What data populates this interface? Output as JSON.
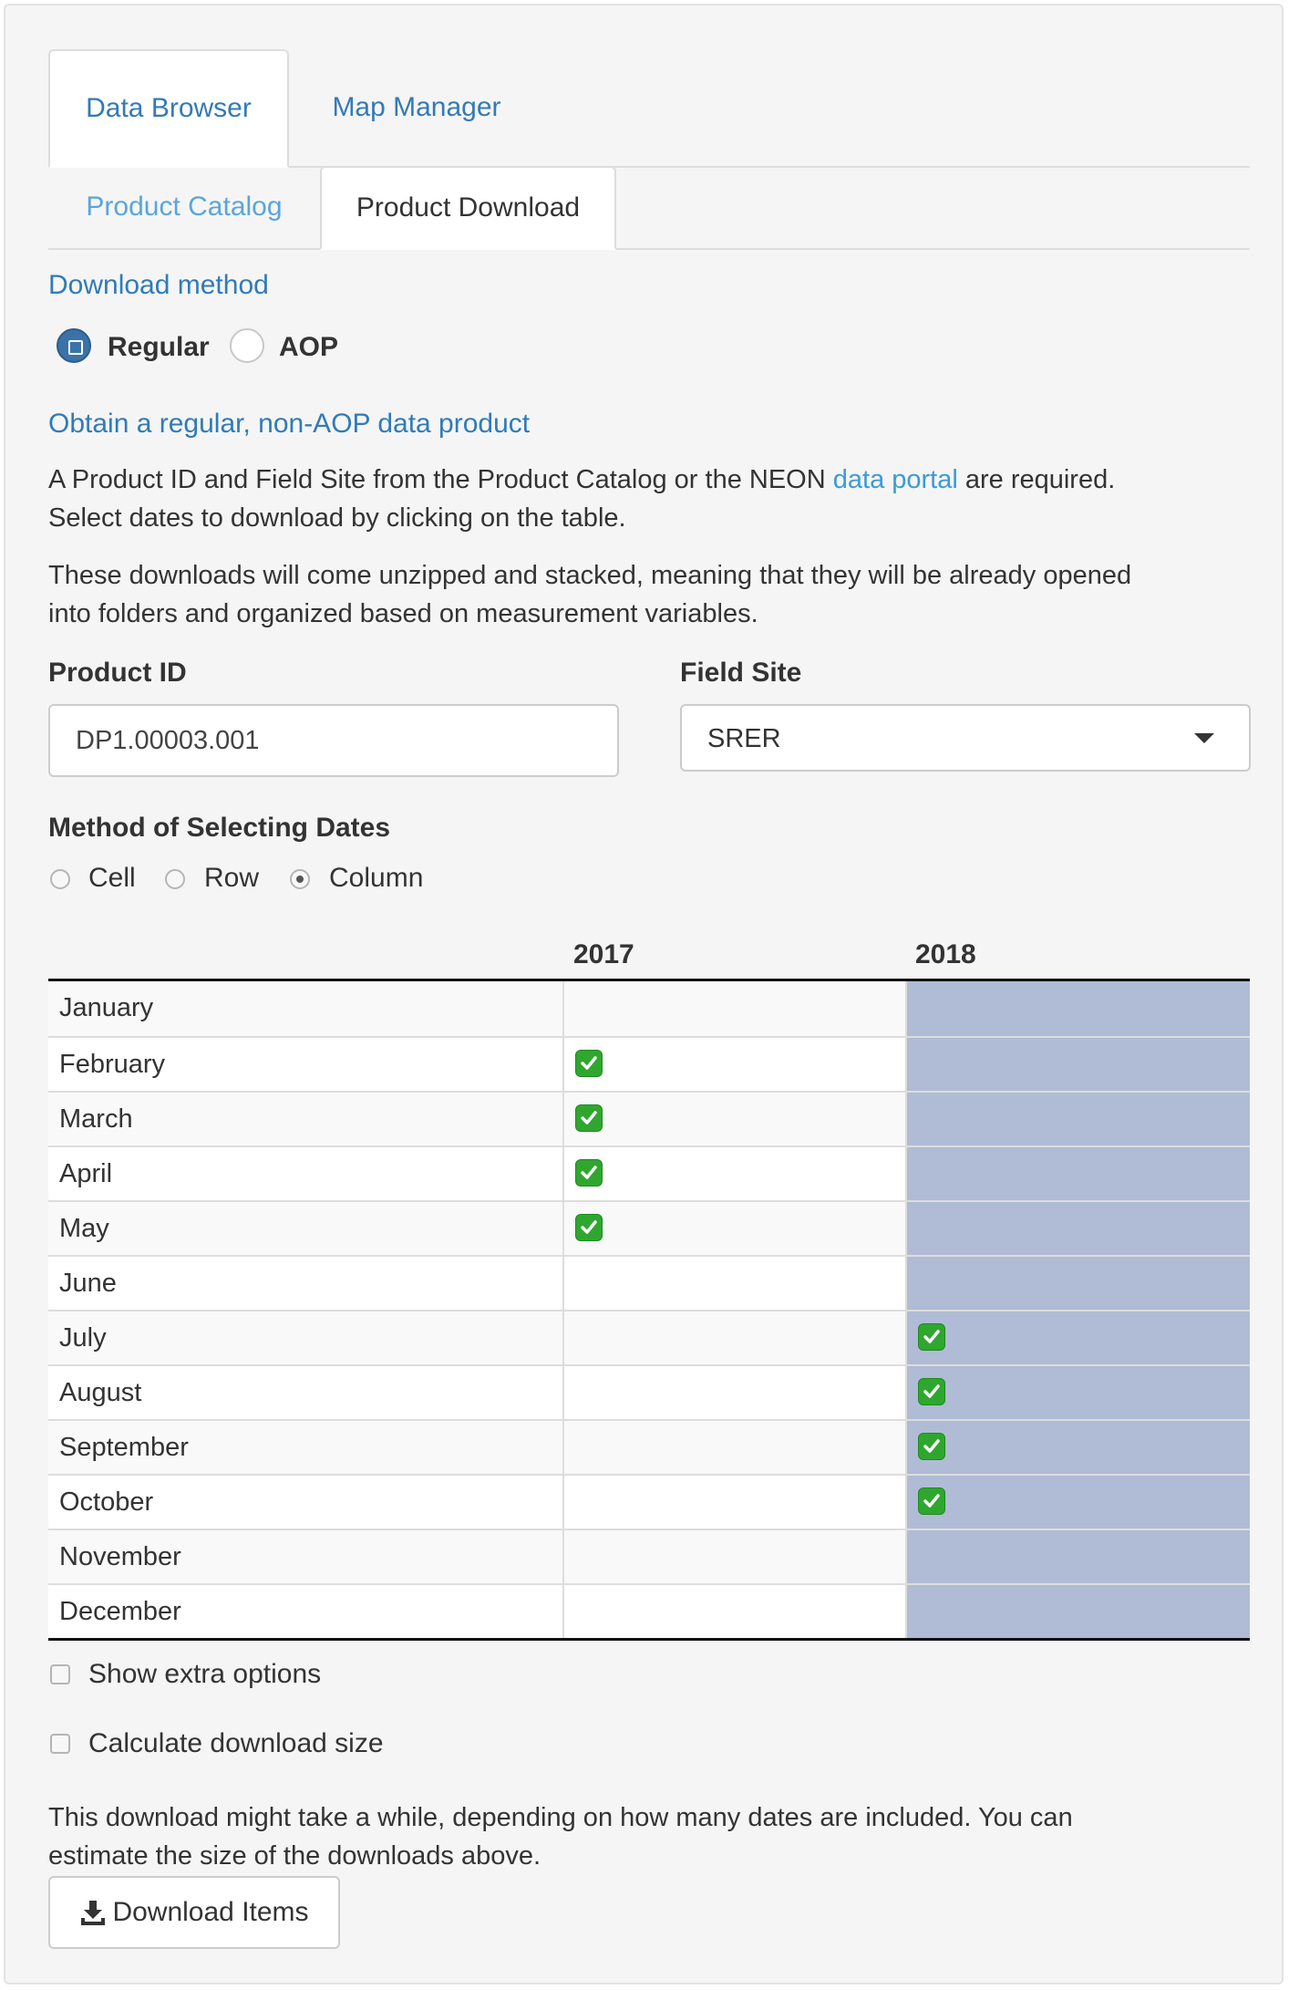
{
  "top_tabs": [
    {
      "label": "Data Browser",
      "active": true
    },
    {
      "label": "Map Manager",
      "active": false
    }
  ],
  "sub_tabs": [
    {
      "label": "Product Catalog",
      "active": false
    },
    {
      "label": "Product Download",
      "active": true
    }
  ],
  "download_method": {
    "heading": "Download method",
    "options": [
      {
        "label": "Regular",
        "selected": true
      },
      {
        "label": "AOP",
        "selected": false
      }
    ]
  },
  "regular_section": {
    "heading": "Obtain a regular, non-AOP data product",
    "para1_before_link": "A Product ID and Field Site from the Product Catalog or the NEON ",
    "para1_link": "data portal",
    "para1_after_link": " are required.",
    "para1_line2": "Select dates to download by clicking on the table.",
    "para2_line1": "These downloads will come unzipped and stacked, meaning that they will be already opened",
    "para2_line2": "into folders and organized based on measurement variables."
  },
  "product_id": {
    "label": "Product ID",
    "value": "DP1.00003.001"
  },
  "field_site": {
    "label": "Field Site",
    "value": "SRER"
  },
  "date_method": {
    "label": "Method of Selecting Dates",
    "options": [
      {
        "label": "Cell",
        "selected": false
      },
      {
        "label": "Row",
        "selected": false
      },
      {
        "label": "Column",
        "selected": true
      }
    ]
  },
  "table": {
    "columns": [
      "2017",
      "2018"
    ],
    "selected_column": "2018",
    "rows": [
      {
        "month": "January",
        "y2017": false,
        "y2018": false
      },
      {
        "month": "February",
        "y2017": true,
        "y2018": false
      },
      {
        "month": "March",
        "y2017": true,
        "y2018": false
      },
      {
        "month": "April",
        "y2017": true,
        "y2018": false
      },
      {
        "month": "May",
        "y2017": true,
        "y2018": false
      },
      {
        "month": "June",
        "y2017": false,
        "y2018": false
      },
      {
        "month": "July",
        "y2017": false,
        "y2018": true
      },
      {
        "month": "August",
        "y2017": false,
        "y2018": true
      },
      {
        "month": "September",
        "y2017": false,
        "y2018": true
      },
      {
        "month": "October",
        "y2017": false,
        "y2018": true
      },
      {
        "month": "November",
        "y2017": false,
        "y2018": false
      },
      {
        "month": "December",
        "y2017": false,
        "y2018": false
      }
    ]
  },
  "options": {
    "show_extra": {
      "label": "Show extra options",
      "checked": false
    },
    "calc_size": {
      "label": "Calculate download size",
      "checked": false
    }
  },
  "footer": {
    "line1": "This download might take a while, depending on how many dates are included. You can",
    "line2": "estimate the size of the downloads above.",
    "button_label": "Download Items"
  },
  "colors": {
    "accent": "#337ab7",
    "link": "#3b9bd8",
    "selected_column": "#b0bcd5",
    "check": "#2fa72f"
  }
}
